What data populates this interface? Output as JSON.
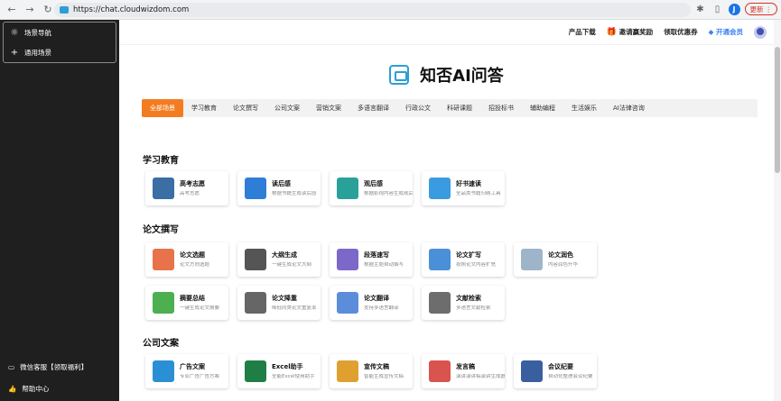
{
  "browser": {
    "url": "https://chat.cloudwizdom.com",
    "profile_initial": "J",
    "update_label": "更新"
  },
  "sidebar": {
    "items": [
      {
        "label": "场景导航",
        "icon": "sun-icon"
      },
      {
        "label": "通用场景",
        "icon": "plus-icon"
      }
    ],
    "bottom": [
      {
        "label": "微信客服【领取福利】",
        "icon": "chat-icon"
      },
      {
        "label": "帮助中心",
        "icon": "thumb-icon"
      }
    ]
  },
  "topnav": {
    "download": "产品下载",
    "invite": "邀请赢奖励",
    "coupon": "领取优惠券",
    "vip": "开通会员"
  },
  "header": {
    "title": "知否AI问答"
  },
  "tabs": [
    "全部场景",
    "学习教育",
    "论文撰写",
    "公司文案",
    "营销文案",
    "多语言翻译",
    "行政公文",
    "科研课题",
    "招投标书",
    "辅助编程",
    "生活娱乐",
    "AI法律咨询"
  ],
  "sections": [
    {
      "title": "学习教育",
      "cards": [
        {
          "title": "高考志愿",
          "desc": "高考志愿",
          "color": "#3a6ea5"
        },
        {
          "title": "读后感",
          "desc": "根据书籍生成读后感",
          "color": "#2e7dd7"
        },
        {
          "title": "观后感",
          "desc": "根据影视内容生成观后感",
          "color": "#2aa198"
        },
        {
          "title": "好书速读",
          "desc": "全品类书籍归纳工具",
          "color": "#3b9be0"
        }
      ]
    },
    {
      "title": "论文撰写",
      "cards": [
        {
          "title": "论文选题",
          "desc": "论文方向选题",
          "color": "#e8734a"
        },
        {
          "title": "大纲生成",
          "desc": "一键生成论文大纲",
          "color": "#555555"
        },
        {
          "title": "段落速写",
          "desc": "根据主题自动撰写",
          "color": "#7b68c8"
        },
        {
          "title": "论文扩写",
          "desc": "按照论文内容扩充",
          "color": "#4a90d9"
        },
        {
          "title": "论文润色",
          "desc": "内容润色升华",
          "color": "#9eb5c9"
        },
        {
          "title": "摘要总结",
          "desc": "一键生成论文摘要",
          "color": "#4caf50"
        },
        {
          "title": "论文降重",
          "desc": "降低同类论文重复率",
          "color": "#666666"
        },
        {
          "title": "论文翻译",
          "desc": "支持多语言翻译",
          "color": "#5c8ddb"
        },
        {
          "title": "文献检索",
          "desc": "多语言文献检索",
          "color": "#6d6d6d"
        }
      ]
    },
    {
      "title": "公司文案",
      "cards": [
        {
          "title": "广告文案",
          "desc": "专业广告广告方案",
          "color": "#2b8fd6"
        },
        {
          "title": "Excel助手",
          "desc": "全能Excel使用助手",
          "color": "#1e7e45"
        },
        {
          "title": "宣传文稿",
          "desc": "智能生成宣传文稿",
          "color": "#e0a030"
        },
        {
          "title": "发言稿",
          "desc": "演讲演讲稿演讲生成器",
          "color": "#d9534f"
        },
        {
          "title": "会议纪要",
          "desc": "自动化整理会议纪要",
          "color": "#3a5f9f"
        }
      ]
    }
  ]
}
